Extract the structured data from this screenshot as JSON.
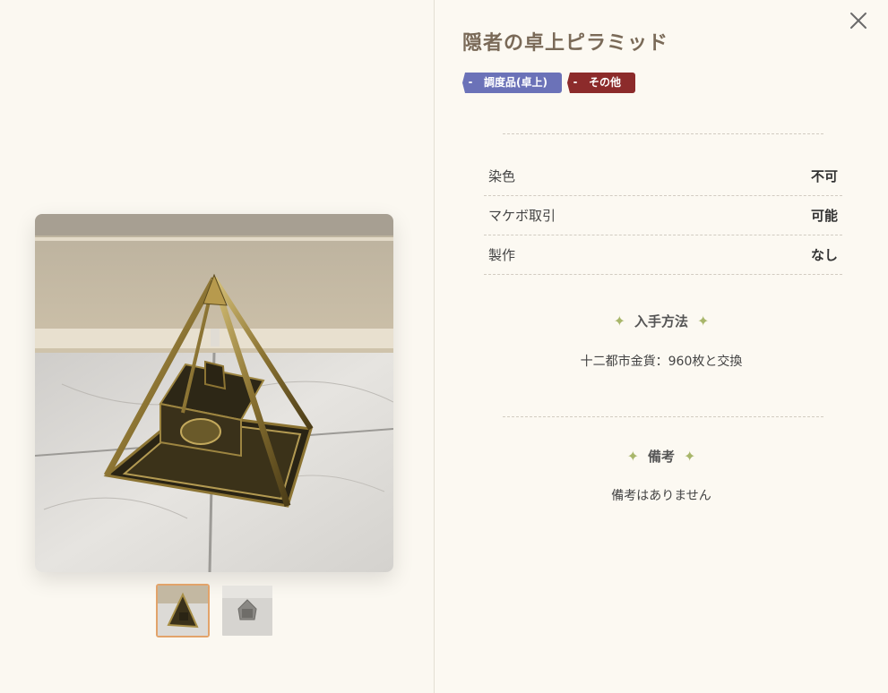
{
  "item": {
    "title": "隠者の卓上ピラミッド",
    "tags": [
      {
        "label": "調度品(卓上)",
        "color": "#6b72b8"
      },
      {
        "label": "その他",
        "color": "#8c2b2b"
      }
    ]
  },
  "properties": [
    {
      "key": "染色",
      "value": "不可"
    },
    {
      "key": "マケボ取引",
      "value": "可能"
    },
    {
      "key": "製作",
      "value": "なし"
    }
  ],
  "acquisition": {
    "heading": "入手方法",
    "text": "十二都市金貨：960枚と交換"
  },
  "notes": {
    "heading": "備考",
    "text": "備考はありません"
  },
  "gallery": {
    "selected_index": 0,
    "thumbnails": [
      "pyramid-photo",
      "pyramid-preview-gray"
    ]
  },
  "icons": {
    "close": "close-icon",
    "sparkle": "sparkle-icon"
  },
  "colors": {
    "background": "#fcf9f2",
    "title": "#7a6a58",
    "accent_thumb_border": "#e2a36a",
    "sparkle": "#a8b66a"
  }
}
